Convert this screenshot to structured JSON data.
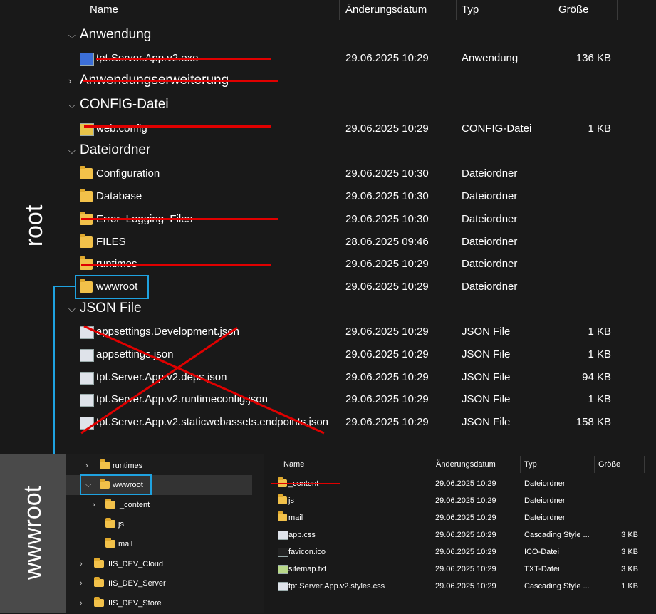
{
  "top": {
    "columns": {
      "name": "Name",
      "date": "Änderungsdatum",
      "type": "Typ",
      "size": "Größe"
    },
    "groups": [
      {
        "label": "Anwendung"
      },
      {
        "label": "Anwendungserweiterung"
      },
      {
        "label": "CONFIG-Datei"
      },
      {
        "label": "Dateiordner"
      },
      {
        "label": "JSON File"
      }
    ],
    "rows": [
      {
        "name": "tpt.Server.App.v2.exe",
        "date": "29.06.2025 10:29",
        "type": "Anwendung",
        "size": "136 KB"
      },
      {
        "name": "web.config",
        "date": "29.06.2025 10:29",
        "type": "CONFIG-Datei",
        "size": "1 KB"
      },
      {
        "name": "Configuration",
        "date": "29.06.2025 10:30",
        "type": "Dateiordner",
        "size": ""
      },
      {
        "name": "Database",
        "date": "29.06.2025 10:30",
        "type": "Dateiordner",
        "size": ""
      },
      {
        "name": "Error_Logging_Files",
        "date": "29.06.2025 10:30",
        "type": "Dateiordner",
        "size": ""
      },
      {
        "name": "FILES",
        "date": "28.06.2025 09:46",
        "type": "Dateiordner",
        "size": ""
      },
      {
        "name": "runtimes",
        "date": "29.06.2025 10:29",
        "type": "Dateiordner",
        "size": ""
      },
      {
        "name": "wwwroot",
        "date": "29.06.2025 10:29",
        "type": "Dateiordner",
        "size": ""
      },
      {
        "name": "appsettings.Development.json",
        "date": "29.06.2025 10:29",
        "type": "JSON File",
        "size": "1 KB"
      },
      {
        "name": "appsettings.json",
        "date": "29.06.2025 10:29",
        "type": "JSON File",
        "size": "1 KB"
      },
      {
        "name": "tpt.Server.App.v2.deps.json",
        "date": "29.06.2025 10:29",
        "type": "JSON File",
        "size": "94 KB"
      },
      {
        "name": "tpt.Server.App.v2.runtimeconfig.json",
        "date": "29.06.2025 10:29",
        "type": "JSON File",
        "size": "1 KB"
      },
      {
        "name": "tpt.Server.App.v2.staticwebassets.endpoints.json",
        "date": "29.06.2025 10:29",
        "type": "JSON File",
        "size": "158 KB"
      }
    ]
  },
  "labels": {
    "root": "root",
    "wwwroot": "wwwroot"
  },
  "nav": {
    "items": [
      "runtimes",
      "wwwroot",
      "_content",
      "js",
      "mail",
      "IIS_DEV_Cloud",
      "IIS_DEV_Server",
      "IIS_DEV_Store"
    ]
  },
  "bottom": {
    "columns": {
      "name": "Name",
      "date": "Änderungsdatum",
      "type": "Typ",
      "size": "Größe"
    },
    "rows": [
      {
        "name": "_content",
        "date": "29.06.2025 10:29",
        "type": "Dateiordner",
        "size": ""
      },
      {
        "name": "js",
        "date": "29.06.2025 10:29",
        "type": "Dateiordner",
        "size": ""
      },
      {
        "name": "mail",
        "date": "29.06.2025 10:29",
        "type": "Dateiordner",
        "size": ""
      },
      {
        "name": "app.css",
        "date": "29.06.2025 10:29",
        "type": "Cascading Style ...",
        "size": "3 KB"
      },
      {
        "name": "favicon.ico",
        "date": "29.06.2025 10:29",
        "type": "ICO-Datei",
        "size": "3 KB"
      },
      {
        "name": "sitemap.txt",
        "date": "29.06.2025 10:29",
        "type": "TXT-Datei",
        "size": "3 KB"
      },
      {
        "name": "tpt.Server.App.v2.styles.css",
        "date": "29.06.2025 10:29",
        "type": "Cascading Style ...",
        "size": "1 KB"
      }
    ]
  },
  "colors": {
    "annotation_red": "#e00000",
    "highlight_blue": "#1fa2e0",
    "folder": "#f2c14a"
  }
}
